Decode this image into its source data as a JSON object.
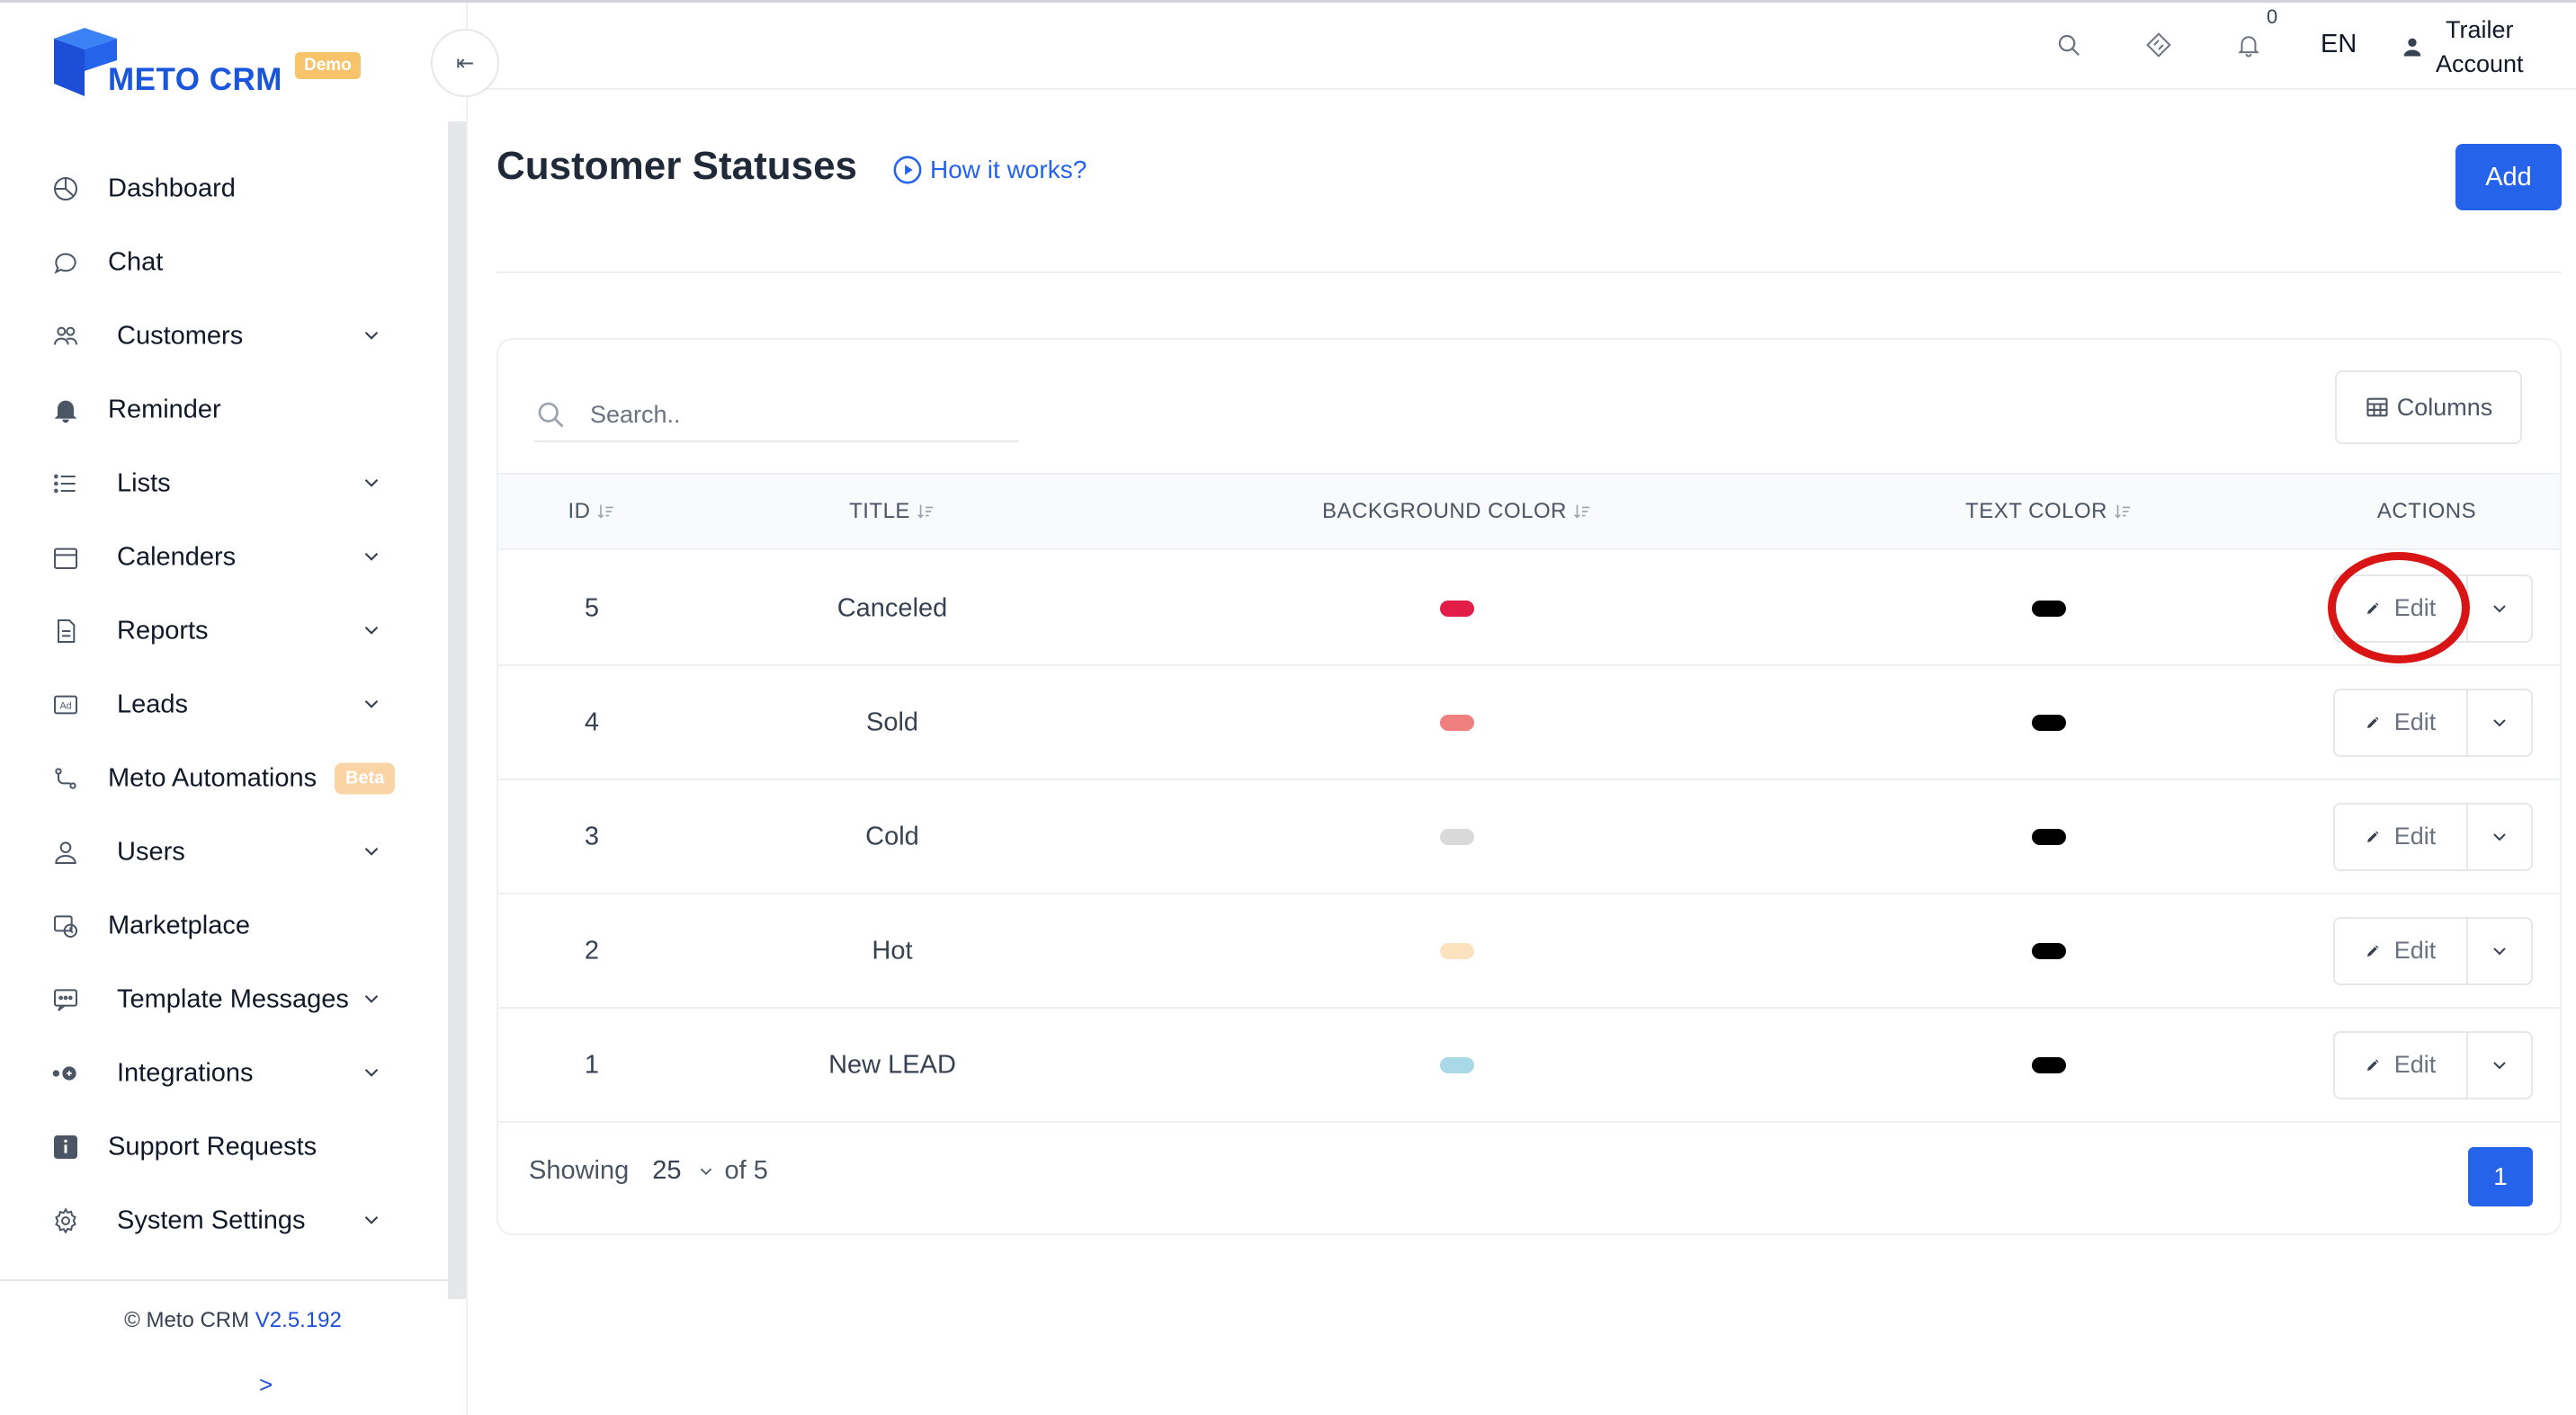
{
  "app": {
    "brand": "METO CRM",
    "brand_badge": "Demo",
    "collapse_glyph": "⇤",
    "brand_color": "#1a56db",
    "accent_color": "#2563eb"
  },
  "sidebar": {
    "items": [
      {
        "label": "Dashboard",
        "icon": "dashboard-icon",
        "has_chevron": false
      },
      {
        "label": "Chat",
        "icon": "chat-icon",
        "has_chevron": false
      },
      {
        "label": "Customers",
        "icon": "customers-icon",
        "has_chevron": true
      },
      {
        "label": "Reminder",
        "icon": "bell-icon",
        "has_chevron": false
      },
      {
        "label": "Lists",
        "icon": "list-icon",
        "has_chevron": true
      },
      {
        "label": "Calenders",
        "icon": "calendar-icon",
        "has_chevron": true
      },
      {
        "label": "Reports",
        "icon": "report-icon",
        "has_chevron": true
      },
      {
        "label": "Leads",
        "icon": "ad-icon",
        "has_chevron": true
      },
      {
        "label": "Meto Automations",
        "icon": "automation-icon",
        "has_chevron": false,
        "badge": "Beta"
      },
      {
        "label": "Users",
        "icon": "user-icon",
        "has_chevron": true
      },
      {
        "label": "Marketplace",
        "icon": "marketplace-icon",
        "has_chevron": false
      },
      {
        "label": "Template Messages",
        "icon": "template-icon",
        "has_chevron": true
      },
      {
        "label": "Integrations",
        "icon": "integrations-icon",
        "has_chevron": true
      },
      {
        "label": "Support Requests",
        "icon": "info-icon",
        "has_chevron": false
      },
      {
        "label": "System Settings",
        "icon": "gear-icon",
        "has_chevron": true
      }
    ],
    "footer": {
      "copyright": "© Meto CRM",
      "version": "V2.5.192",
      "expand_glyph": ">"
    }
  },
  "header": {
    "notification_count": "0",
    "language": "EN",
    "account_line1": "Trailer",
    "account_line2": "Account"
  },
  "page": {
    "title": "Customer Statuses",
    "how_it_works": "How it works?",
    "add_label": "Add"
  },
  "table": {
    "search_placeholder": "Search..",
    "columns_label": "Columns",
    "headers": {
      "id": "ID",
      "title": "TITLE",
      "background_color": "BACKGROUND COLOR",
      "text_color": "TEXT COLOR",
      "actions": "ACTIONS"
    },
    "edit_label": "Edit",
    "rows": [
      {
        "id": "5",
        "title": "Canceled",
        "background_color": "#e11d48",
        "text_color": "#000000"
      },
      {
        "id": "4",
        "title": "Sold",
        "background_color": "#f08080",
        "text_color": "#000000"
      },
      {
        "id": "3",
        "title": "Cold",
        "background_color": "#d9d9d9",
        "text_color": "#000000"
      },
      {
        "id": "2",
        "title": "Hot",
        "background_color": "#fde2bf",
        "text_color": "#000000"
      },
      {
        "id": "1",
        "title": "New LEAD",
        "background_color": "#a9d8e6",
        "text_color": "#000000"
      }
    ],
    "footer": {
      "showing_label": "Showing",
      "per_page": "25",
      "of_label": "of 5",
      "current_page": "1"
    }
  },
  "annotation": {
    "highlight_color": "#d81414",
    "highlighted_element": "edit-button row 5"
  }
}
